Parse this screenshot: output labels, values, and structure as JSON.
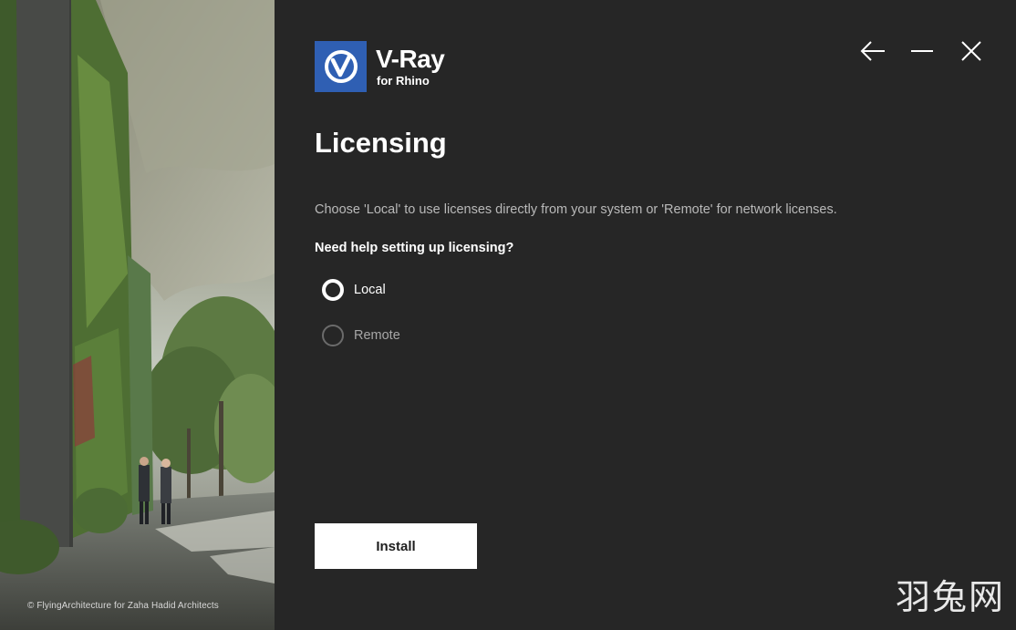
{
  "hero": {
    "image": "architecture-green-wall-lobby",
    "credit": "© FlyingArchitecture for Zaha Hadid Architects"
  },
  "brand": {
    "name": "V-Ray",
    "subtitle": "for Rhino",
    "icon": "vray-logo-icon",
    "color": "#2f5fb3"
  },
  "window_controls": {
    "back": "arrow-left-icon",
    "minimize": "minimize-icon",
    "close": "close-icon"
  },
  "page": {
    "title": "Licensing",
    "description": "Choose 'Local' to use licenses directly from your system or 'Remote' for network licenses.",
    "help_link": "Need help setting up licensing?"
  },
  "license_options": [
    {
      "label": "Local",
      "selected": true
    },
    {
      "label": "Remote",
      "selected": false
    }
  ],
  "actions": {
    "install_label": "Install"
  },
  "watermark": "羽兔网",
  "colors": {
    "background": "#262626",
    "text_primary": "#ffffff",
    "text_secondary": "#b9b9b9",
    "button_bg": "#ffffff"
  }
}
